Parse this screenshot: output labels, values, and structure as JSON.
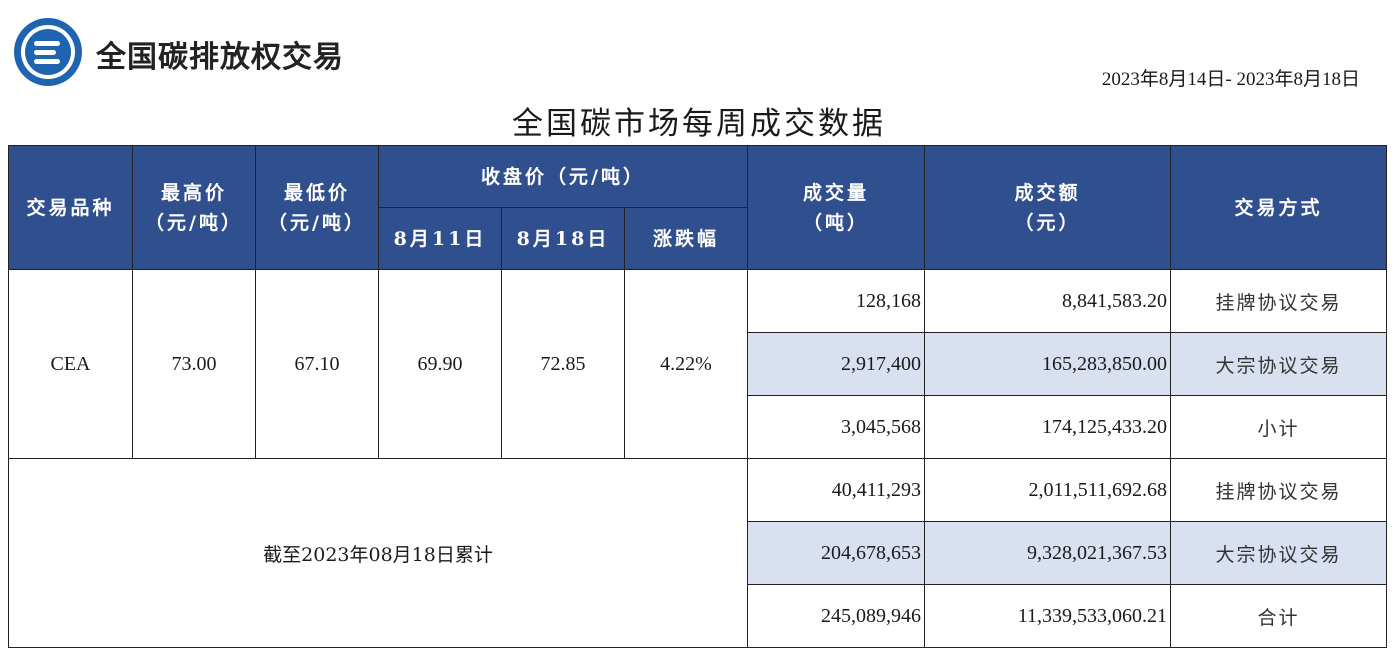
{
  "brand": {
    "name": "全国碳排放权交易"
  },
  "date_range": "2023年8月14日- 2023年8月18日",
  "title": "全国碳市场每周成交数据",
  "headers": {
    "variety": "交易品种",
    "high": "最高价",
    "high_unit": "（元/吨）",
    "low": "最低价",
    "low_unit": "（元/吨）",
    "close": "收盘价（元/吨）",
    "close_prev": "8月11日",
    "close_curr": "8月18日",
    "change": "涨跌幅",
    "volume": "成交量",
    "volume_unit": "（吨）",
    "amount": "成交额",
    "amount_unit": "（元）",
    "method": "交易方式"
  },
  "weekly": {
    "variety": "CEA",
    "high": "73.00",
    "low": "67.10",
    "close_prev": "69.90",
    "close_curr": "72.85",
    "change": "4.22%",
    "rows": [
      {
        "volume": "128,168",
        "amount": "8,841,583.20",
        "method": "挂牌协议交易"
      },
      {
        "volume": "2,917,400",
        "amount": "165,283,850.00",
        "method": "大宗协议交易"
      },
      {
        "volume": "3,045,568",
        "amount": "174,125,433.20",
        "method": "小计"
      }
    ]
  },
  "cumulative": {
    "label": "截至2023年08月18日累计",
    "rows": [
      {
        "volume": "40,411,293",
        "amount": "2,011,511,692.68",
        "method": "挂牌协议交易"
      },
      {
        "volume": "204,678,653",
        "amount": "9,328,021,367.53",
        "method": "大宗协议交易"
      },
      {
        "volume": "245,089,946",
        "amount": "11,339,533,060.21",
        "method": "合计"
      }
    ]
  },
  "colors": {
    "header_bg": "#2f4f8f",
    "row_shade": "#d9e0f0"
  }
}
